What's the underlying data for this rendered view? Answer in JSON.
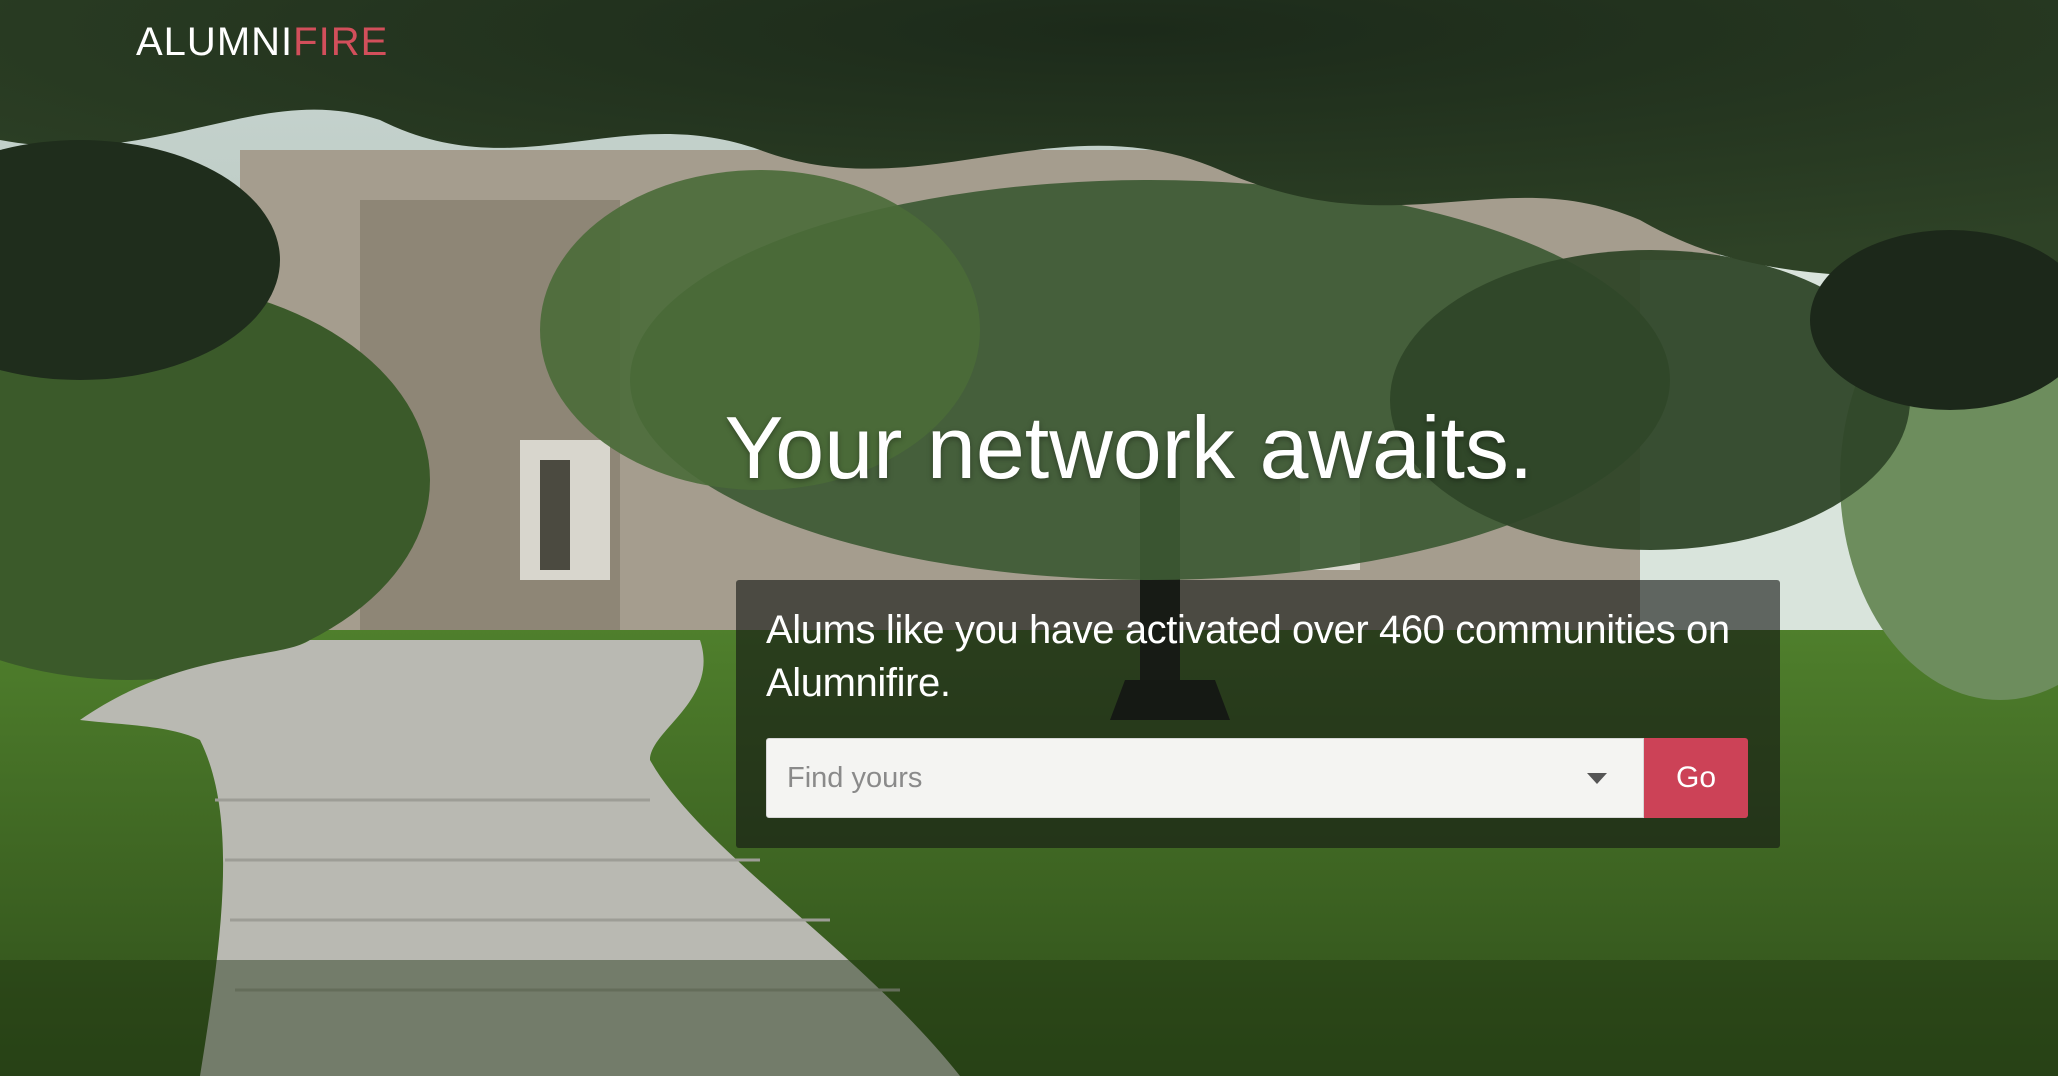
{
  "brand": {
    "logo_part1": "ALUMNI",
    "logo_part2": "FIRE",
    "accent_color": "#d24f5b"
  },
  "hero": {
    "headline": "Your network awaits.",
    "subtext": "Alums like you have activated over 460 communities on Alumnifire."
  },
  "search": {
    "placeholder": "Find yours",
    "value": "",
    "dropdown_icon": "caret-down-icon",
    "button_label": "Go",
    "button_color": "#cc4257"
  }
}
